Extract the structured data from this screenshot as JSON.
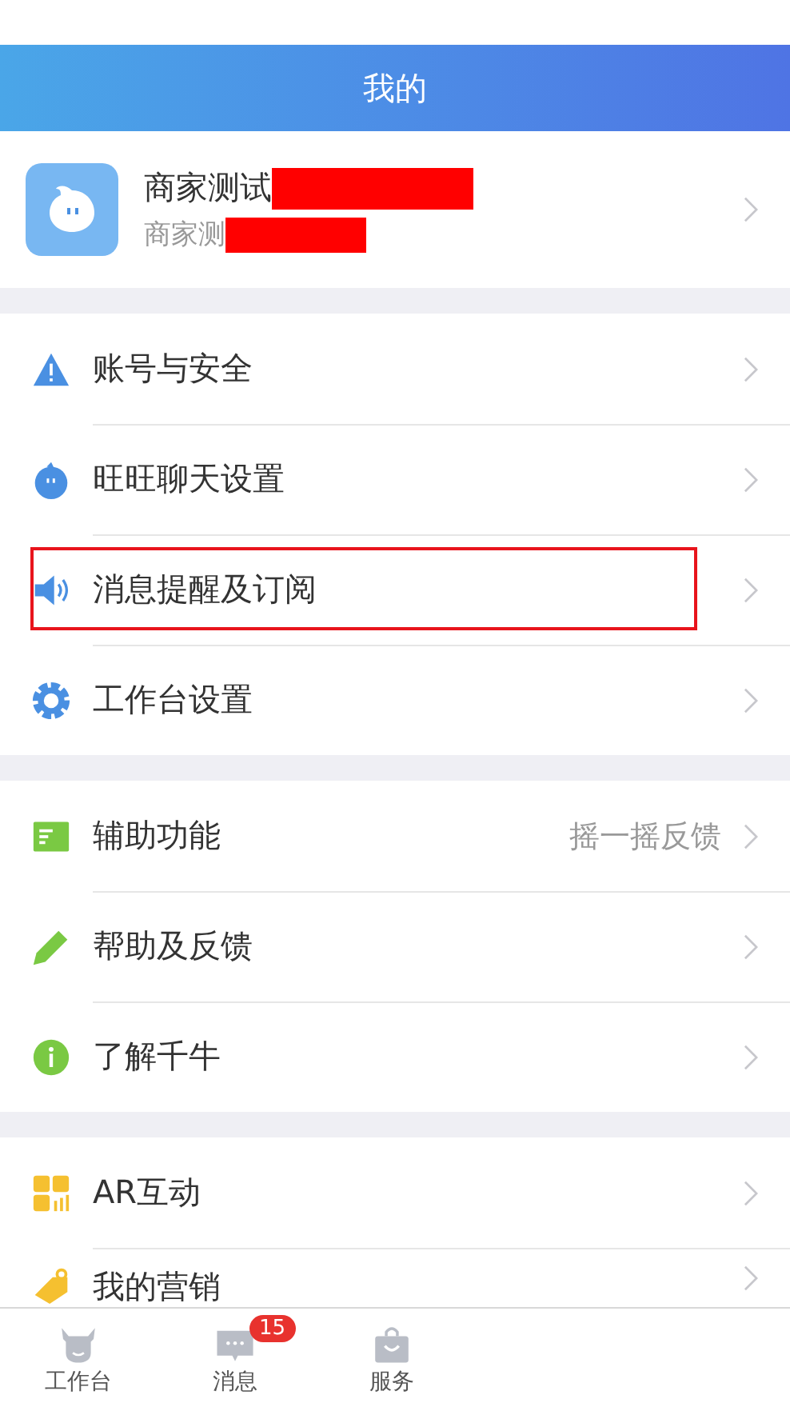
{
  "header": {
    "title": "我的"
  },
  "profile": {
    "name": "商家测试",
    "subtitle": "商家测"
  },
  "groups": [
    {
      "items": [
        {
          "label": "账号与安全",
          "highlighted": false
        },
        {
          "label": "旺旺聊天设置",
          "highlighted": false
        },
        {
          "label": "消息提醒及订阅",
          "highlighted": true
        },
        {
          "label": "工作台设置",
          "highlighted": false
        }
      ]
    },
    {
      "items": [
        {
          "label": "辅助功能",
          "value": "摇一摇反馈",
          "highlighted": false
        },
        {
          "label": "帮助及反馈",
          "highlighted": false
        },
        {
          "label": "了解千牛",
          "highlighted": false
        }
      ]
    },
    {
      "items": [
        {
          "label": "AR互动",
          "highlighted": false
        },
        {
          "label": "我的营销",
          "highlighted": false
        }
      ]
    }
  ],
  "tab_bar": [
    {
      "label": "工作台"
    },
    {
      "label": "消息",
      "badge": "15"
    },
    {
      "label": "服务"
    }
  ]
}
